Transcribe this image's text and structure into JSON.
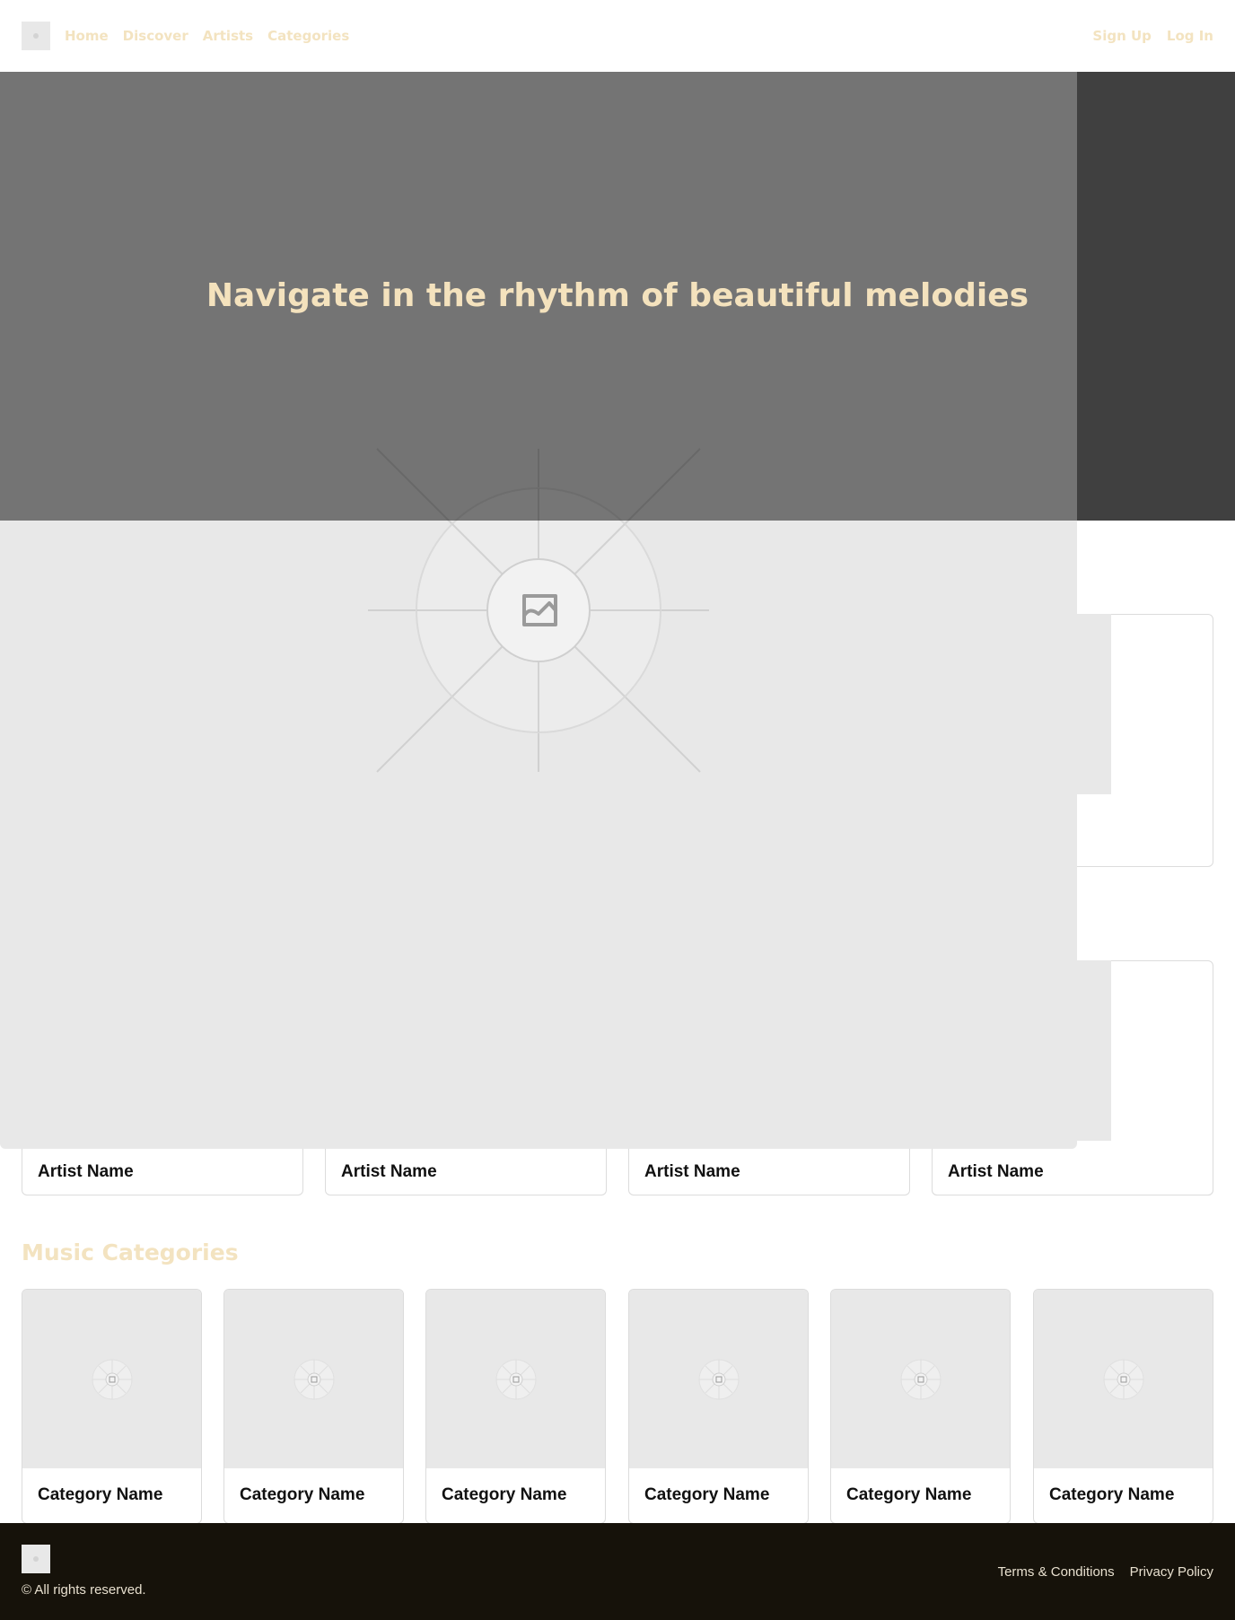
{
  "header": {
    "logo_icon": "image-placeholder-icon",
    "nav": [
      "Home",
      "Discover",
      "Artists",
      "Categories"
    ],
    "auth": {
      "signup": "Sign Up",
      "login": "Log In"
    }
  },
  "hero": {
    "title": "Navigate in the rhythm of beautiful melodies",
    "image_icon": "image-placeholder-icon"
  },
  "artists": {
    "items": [
      {
        "name": "Artist Name"
      },
      {
        "name": "Artist Name"
      },
      {
        "name": "Artist Name"
      },
      {
        "name": "Artist Name"
      }
    ]
  },
  "categories": {
    "title": "Music Categories",
    "items": [
      {
        "name": "Category Name"
      },
      {
        "name": "Category Name"
      },
      {
        "name": "Category Name"
      },
      {
        "name": "Category Name"
      },
      {
        "name": "Category Name"
      },
      {
        "name": "Category Name"
      }
    ]
  },
  "footer": {
    "logo_icon": "image-placeholder-icon",
    "copyright": "© All rights reserved.",
    "links": [
      "Terms & Conditions",
      "Privacy Policy"
    ]
  },
  "colors": {
    "accent": "#f3e3c0",
    "hero_title": "#f4e2bd",
    "footer_bg": "#16120a",
    "placeholder": "#e8e8e8"
  }
}
